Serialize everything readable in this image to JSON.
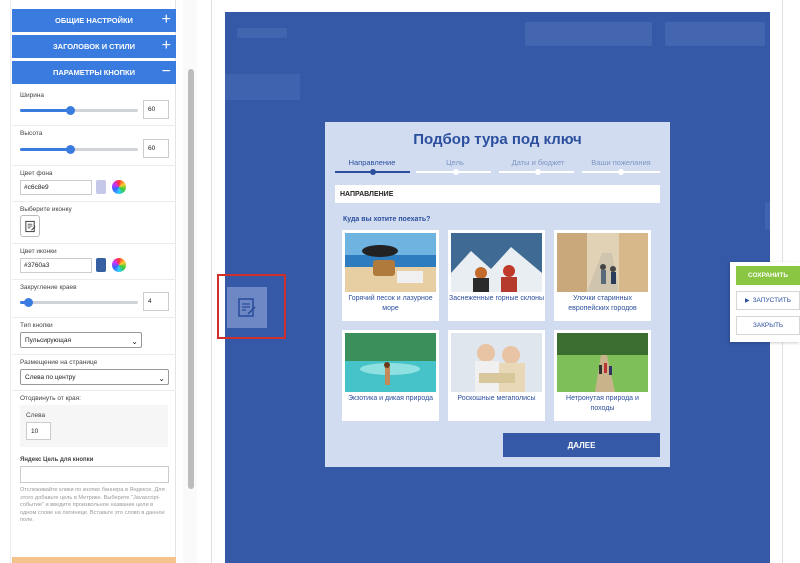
{
  "sidebar": {
    "sections": [
      {
        "label": "Общие настройки",
        "sign": "+"
      },
      {
        "label": "Заголовок и стили",
        "sign": "+"
      },
      {
        "label": "Параметры кнопки",
        "sign": "−"
      }
    ],
    "width": {
      "label": "Ширина",
      "value": "60",
      "fraction": 0.42
    },
    "height": {
      "label": "Высота",
      "value": "60",
      "fraction": 0.42
    },
    "bg_color": {
      "label": "Цвет фона",
      "value": "#c6c8e9",
      "swatch": "#c6c8e9"
    },
    "choose_icon": {
      "label": "Выберите иконку"
    },
    "icon_color": {
      "label": "Цвет иконки",
      "value": "#3760a3",
      "swatch": "#3760a3"
    },
    "radius": {
      "label": "Закругление краев",
      "value": "4",
      "fraction": 0.07
    },
    "button_type": {
      "label": "Тип кнопки",
      "value": "Пульсирующая"
    },
    "placement": {
      "label": "Размещение на странице",
      "value": "Слева по центру"
    },
    "indent": {
      "label": "Отодвинуть от края:",
      "sub_label": "Слева",
      "value": "10"
    },
    "yandex_goal": {
      "label": "Яндекс Цель для кнопки",
      "value": "",
      "help": "Отслеживайте клики по кнопке баннера в Яндексе. Для этого добавьте цель в Метрике. Выберите \"Javascript-событие\" и введите произвольное название цели в одном слове на латинице. Вставьте это слово в данное поле."
    }
  },
  "modal": {
    "title": "Подбор тура под ключ",
    "steps": [
      "Направление",
      "Цель",
      "Даты и бюджет",
      "Ваши пожелания"
    ],
    "active_step": 0,
    "category": "НАПРАВЛЕНИЕ",
    "question": "Куда вы хотите поехать?",
    "options": [
      {
        "caption": "Горячий песок и лазурное море"
      },
      {
        "caption": "Заснеженные горные склоны"
      },
      {
        "caption": "Улочки старинных европейских городов"
      },
      {
        "caption": "Экзотика и дикая природа"
      },
      {
        "caption": "Роскошные мегаполисы"
      },
      {
        "caption": "Нетронутая природа и походы"
      }
    ],
    "next_label": "ДАЛЕЕ"
  },
  "actions": {
    "save": "СОХРАНИТЬ",
    "run": "ЗАПУСТИТЬ",
    "close": "ЗАКРЫТЬ"
  },
  "colors": {
    "accent": "#3a7be0",
    "site_bg": "#3559a6",
    "modal_bg": "#d1dcf1",
    "save_green": "#8ac641",
    "highlight_red": "#d0302b"
  }
}
